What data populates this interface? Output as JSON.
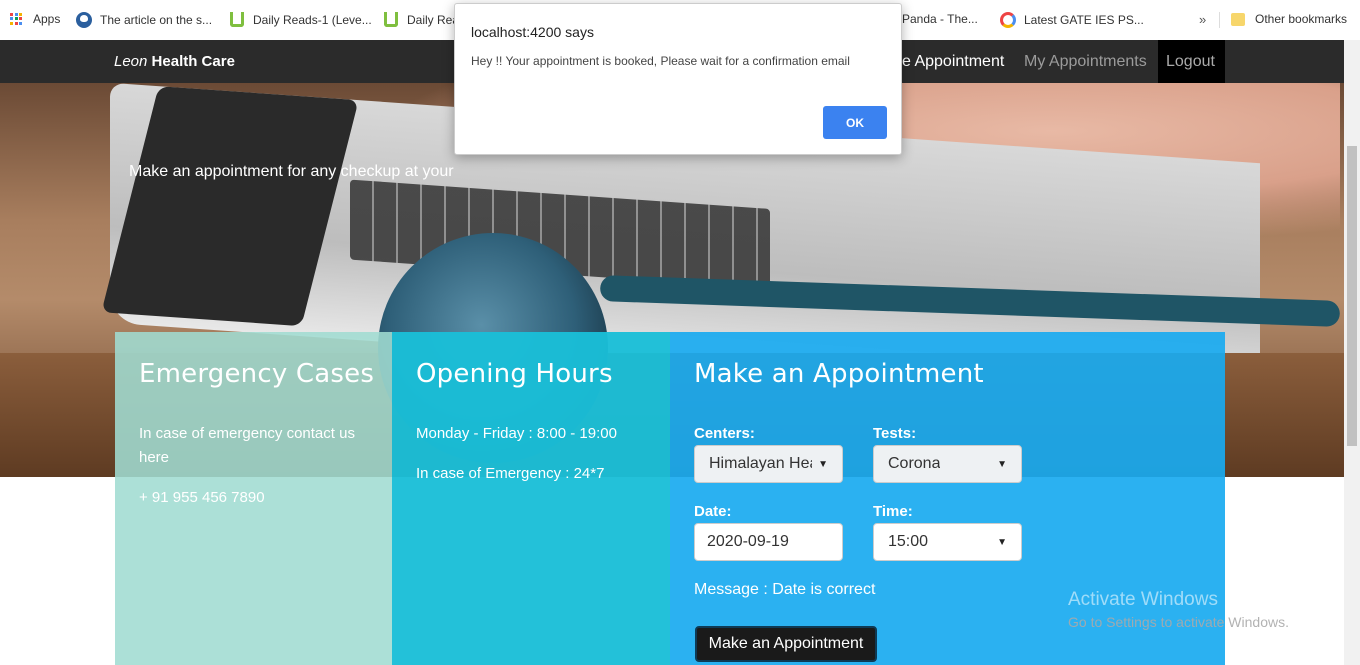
{
  "bookmarks": {
    "apps": "Apps",
    "items": [
      "The article on the s...",
      "Daily Reads-1 (Leve...",
      "Daily Rea",
      "Panda - The...",
      "Latest GATE IES PS..."
    ],
    "overflow": "»",
    "other": "Other bookmarks"
  },
  "navbar": {
    "brand_italic": "Leon",
    "brand_bold": "Health Care",
    "links": [
      "e Appointment",
      "My Appointments",
      "Logout"
    ]
  },
  "hero": {
    "tagline": "Make an appointment for any checkup at your"
  },
  "emergency": {
    "title": "Emergency Cases",
    "text": "In case of emergency contact us here",
    "phone": "+ 91 955 456 7890"
  },
  "hours": {
    "title": "Opening Hours",
    "weekdays": "Monday - Friday : 8:00 - 19:00",
    "emergency": "In case of Emergency : 24*7"
  },
  "appointment": {
    "title": "Make an Appointment",
    "centers_label": "Centers:",
    "centers_value": "Himalayan Hea",
    "tests_label": "Tests:",
    "tests_value": "Corona",
    "date_label": "Date:",
    "date_value": "2020-09-19",
    "time_label": "Time:",
    "time_value": "15:00",
    "message": "Message : Date is correct",
    "submit": "Make an Appointment"
  },
  "watermark": {
    "line1": "Activate Windows",
    "line2": "Go to Settings to activate Windows."
  },
  "dialog": {
    "title": "localhost:4200 says",
    "message": "Hey !! Your appointment is booked, Please wait for a confirmation email",
    "ok": "OK"
  }
}
